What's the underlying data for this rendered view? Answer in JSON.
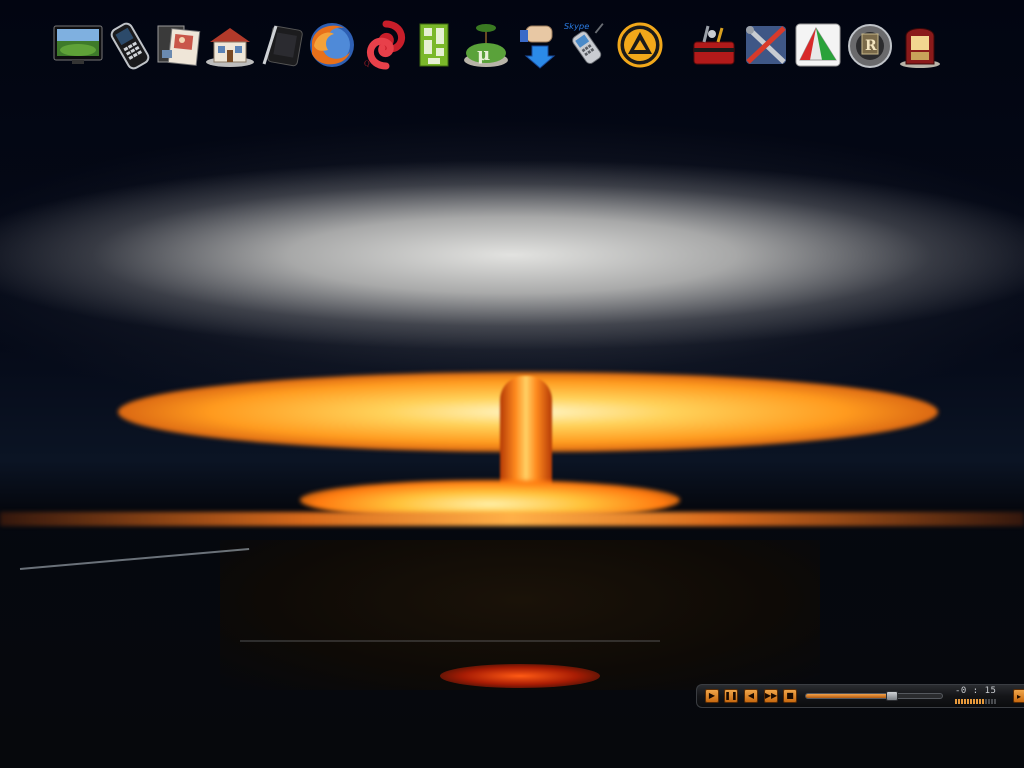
{
  "desktop": {
    "icons": [
      {
        "name": "tv-monitor-icon"
      },
      {
        "name": "mobile-phone-icon"
      },
      {
        "name": "photo-album-icon"
      },
      {
        "name": "home-house-icon"
      },
      {
        "name": "drawing-tablet-icon"
      },
      {
        "name": "firefox-icon"
      },
      {
        "name": "opera-qip-swirl-icon"
      },
      {
        "name": "qip-messenger-icon"
      },
      {
        "name": "utorrent-island-icon"
      },
      {
        "name": "download-hand-icon"
      },
      {
        "name": "skype-phone-icon",
        "label": "Skype"
      },
      {
        "name": "aimp-player-icon"
      },
      {
        "name": "toolbox-icon"
      },
      {
        "name": "repair-tools-icon"
      },
      {
        "name": "paint-palette-icon"
      },
      {
        "name": "media-wheel-icon"
      },
      {
        "name": "jukebox-icon"
      }
    ]
  },
  "media_player": {
    "buttons": [
      {
        "name": "play-button",
        "glyph": "▶"
      },
      {
        "name": "pause-button",
        "glyph": "❚❚"
      },
      {
        "name": "previous-button",
        "glyph": "◀"
      },
      {
        "name": "next-button",
        "glyph": "▶▶"
      },
      {
        "name": "stop-button",
        "glyph": "■"
      }
    ],
    "time": "-0 : 15",
    "seek_progress": 0.63,
    "volume_level": 0.7,
    "accent_color": "#e08a2c"
  }
}
